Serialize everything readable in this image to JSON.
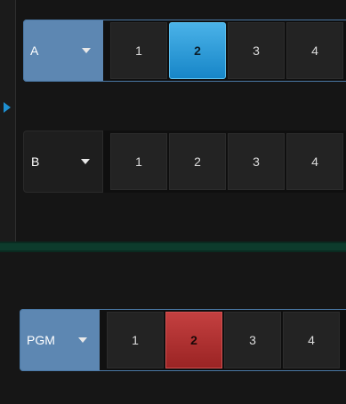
{
  "buses": {
    "a": {
      "label": "A",
      "buttons": [
        "1",
        "2",
        "3",
        "4"
      ],
      "active_index": 1,
      "active_color": "#1e8fd0"
    },
    "b": {
      "label": "B",
      "buttons": [
        "1",
        "2",
        "3",
        "4"
      ],
      "active_index": null
    },
    "pgm": {
      "label": "PGM",
      "buttons": [
        "1",
        "2",
        "3",
        "4"
      ],
      "active_index": 1,
      "active_color": "#b83232"
    }
  },
  "icons": {
    "dropdown": "chevron-down-icon",
    "rail_marker": "triangle-right-icon"
  },
  "colors": {
    "bus_select_active": "#5d87b2",
    "divider": "#0d3b2c",
    "background": "#141414"
  }
}
